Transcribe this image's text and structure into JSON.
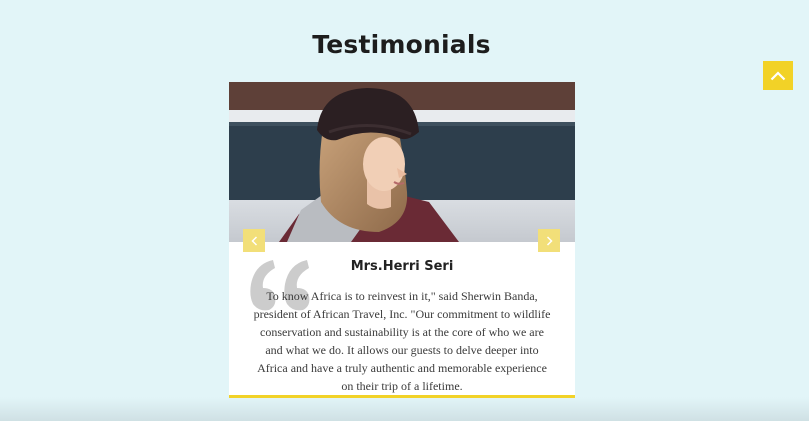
{
  "section": {
    "title": "Testimonials"
  },
  "back_to_top": {
    "icon": "chevron-up-icon"
  },
  "testimonial": {
    "name": "Mrs.Herri Seri",
    "quote": "To know Africa is to reinvest in it,\" said Sherwin Banda, president of African Travel, Inc. \"Our commitment to wildlife conservation and sustainability is at the core of who we are and what we do. It allows our guests to delve deeper into Africa and have a truly authentic and memorable experience on their trip of a lifetime.",
    "quote_icon": "quote-icon",
    "photo": "woman-in-beanie-photo"
  },
  "carousel": {
    "prev_icon": "chevron-left-icon",
    "next_icon": "chevron-right-icon"
  },
  "colors": {
    "background": "#e2f5f8",
    "accent": "#f2d227",
    "arrow_bg": "#f2df79",
    "card": "#ffffff",
    "heading": "#1d1d1d",
    "body_text": "#3a3a3a"
  }
}
